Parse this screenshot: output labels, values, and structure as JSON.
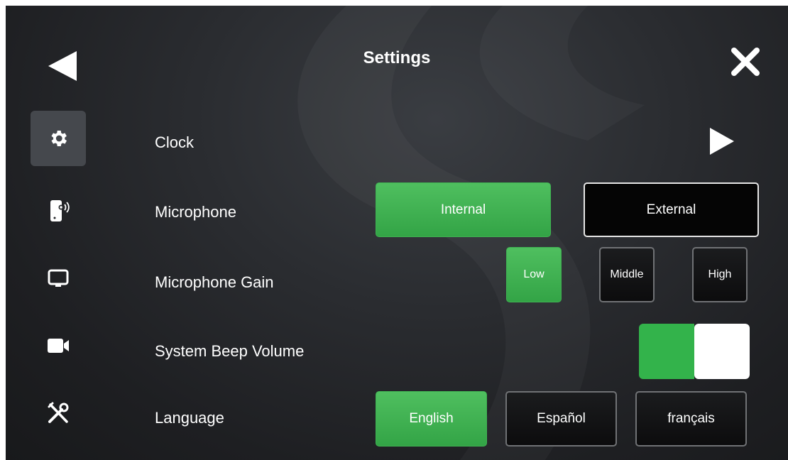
{
  "header": {
    "title": "Settings"
  },
  "icons": {
    "back": "back-triangle-icon",
    "close": "close-x-icon",
    "sidebar": [
      "gear-icon",
      "phone-speaker-icon",
      "monitor-icon",
      "camera-icon",
      "tools-icon"
    ]
  },
  "rows": {
    "clock": {
      "label": "Clock"
    },
    "microphone": {
      "label": "Microphone",
      "options": [
        "Internal",
        "External"
      ],
      "selected": "Internal"
    },
    "gain": {
      "label": "Microphone Gain",
      "options": [
        "Low",
        "Middle",
        "High"
      ],
      "selected": "Low"
    },
    "beep": {
      "label": "System Beep Volume",
      "level": 0.5
    },
    "language": {
      "label": "Language",
      "options": [
        "English",
        "Español",
        "français"
      ],
      "selected": "English"
    }
  },
  "colors": {
    "accent": "#33b34b",
    "background": "#25272a",
    "sidebar_active": "#45484d"
  }
}
